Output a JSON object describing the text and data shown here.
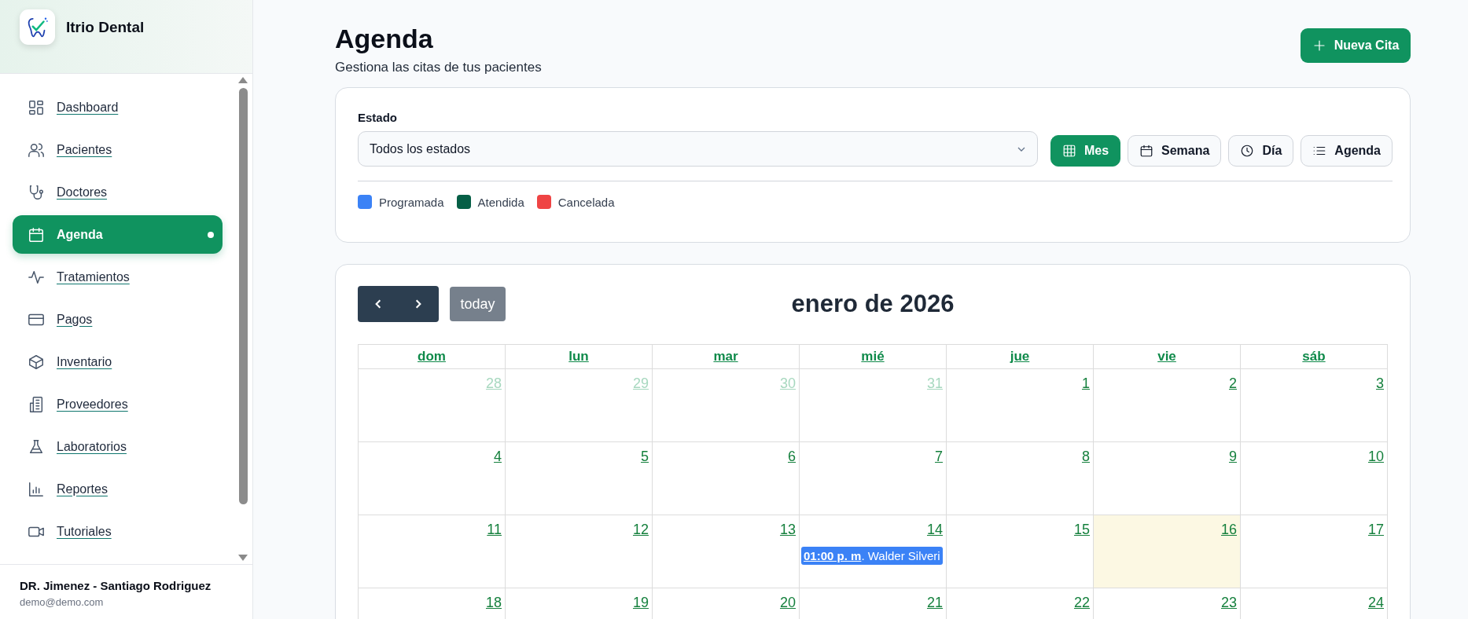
{
  "brand": {
    "name": "Itrio Dental"
  },
  "sidebar": {
    "items": [
      {
        "label": "Dashboard",
        "selected": false
      },
      {
        "label": "Pacientes",
        "selected": false
      },
      {
        "label": "Doctores",
        "selected": false
      },
      {
        "label": "Agenda",
        "selected": true
      },
      {
        "label": "Tratamientos",
        "selected": false
      },
      {
        "label": "Pagos",
        "selected": false
      },
      {
        "label": "Inventario",
        "selected": false
      },
      {
        "label": "Proveedores",
        "selected": false
      },
      {
        "label": "Laboratorios",
        "selected": false
      },
      {
        "label": "Reportes",
        "selected": false
      },
      {
        "label": "Tutoriales",
        "selected": false
      }
    ],
    "user": {
      "name": "DR. Jimenez - Santiago Rodriguez",
      "email": "demo@demo.com"
    }
  },
  "page": {
    "title": "Agenda",
    "subtitle": "Gestiona las citas de tus pacientes",
    "new_button": "Nueva Cita"
  },
  "filters": {
    "label": "Estado",
    "select_value": "Todos los estados",
    "views": [
      {
        "label": "Mes",
        "selected": true
      },
      {
        "label": "Semana",
        "selected": false
      },
      {
        "label": "Día",
        "selected": false
      },
      {
        "label": "Agenda",
        "selected": false
      }
    ],
    "legend": [
      {
        "label": "Programada",
        "color": "#3b82f6"
      },
      {
        "label": "Atendida",
        "color": "#065f46"
      },
      {
        "label": "Cancelada",
        "color": "#ef4444"
      }
    ]
  },
  "calendar": {
    "today_button": "today",
    "title": "enero de 2026",
    "weekdays": [
      "dom",
      "lun",
      "mar",
      "mié",
      "jue",
      "vie",
      "sáb"
    ],
    "weeks": [
      {
        "days": [
          {
            "number": "28",
            "other_month": true,
            "today": false
          },
          {
            "number": "29",
            "other_month": true,
            "today": false
          },
          {
            "number": "30",
            "other_month": true,
            "today": false
          },
          {
            "number": "31",
            "other_month": true,
            "today": false
          },
          {
            "number": "1",
            "other_month": false,
            "today": false
          },
          {
            "number": "2",
            "other_month": false,
            "today": false
          },
          {
            "number": "3",
            "other_month": false,
            "today": false
          }
        ]
      },
      {
        "days": [
          {
            "number": "4",
            "other_month": false,
            "today": false
          },
          {
            "number": "5",
            "other_month": false,
            "today": false
          },
          {
            "number": "6",
            "other_month": false,
            "today": false
          },
          {
            "number": "7",
            "other_month": false,
            "today": false
          },
          {
            "number": "8",
            "other_month": false,
            "today": false
          },
          {
            "number": "9",
            "other_month": false,
            "today": false
          },
          {
            "number": "10",
            "other_month": false,
            "today": false
          }
        ]
      },
      {
        "days": [
          {
            "number": "11",
            "other_month": false,
            "today": false
          },
          {
            "number": "12",
            "other_month": false,
            "today": false
          },
          {
            "number": "13",
            "other_month": false,
            "today": false
          },
          {
            "number": "14",
            "other_month": false,
            "today": false,
            "events": [
              {
                "time": "01:00 p. m",
                "title": ". Walder Silveri",
                "color": "#3b82f6"
              }
            ]
          },
          {
            "number": "15",
            "other_month": false,
            "today": false
          },
          {
            "number": "16",
            "other_month": false,
            "today": true
          },
          {
            "number": "17",
            "other_month": false,
            "today": false
          }
        ]
      },
      {
        "days": [
          {
            "number": "18",
            "other_month": false,
            "today": false
          },
          {
            "number": "19",
            "other_month": false,
            "today": false
          },
          {
            "number": "20",
            "other_month": false,
            "today": false
          },
          {
            "number": "21",
            "other_month": false,
            "today": false
          },
          {
            "number": "22",
            "other_month": false,
            "today": false
          },
          {
            "number": "23",
            "other_month": false,
            "today": false
          },
          {
            "number": "24",
            "other_month": false,
            "today": false
          }
        ]
      }
    ]
  }
}
